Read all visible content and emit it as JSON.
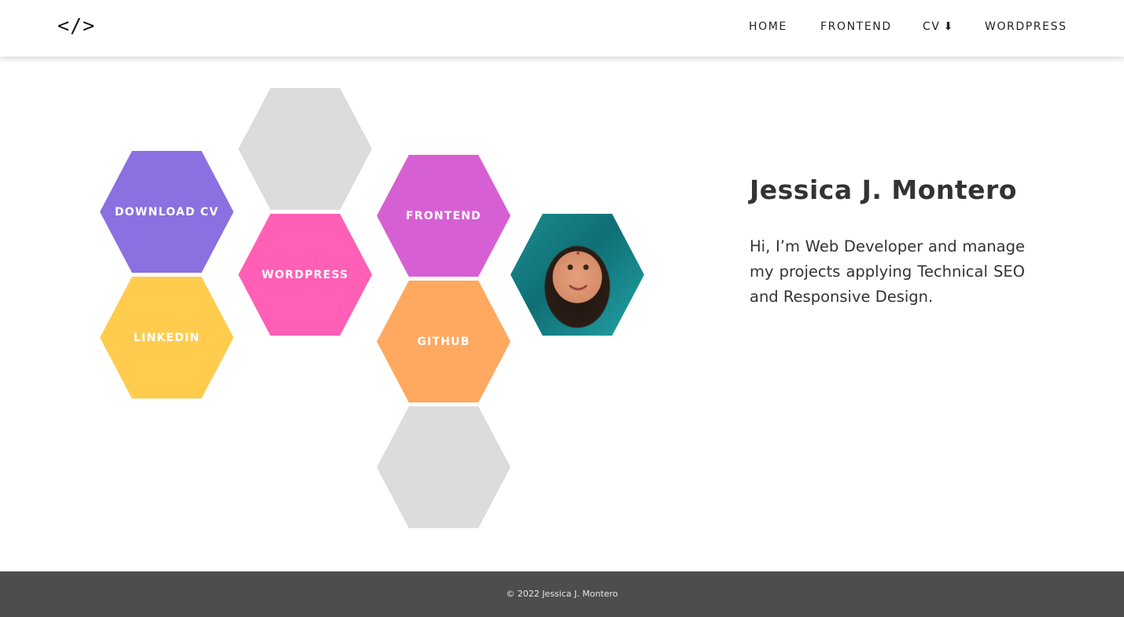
{
  "header": {
    "logo": "</>",
    "nav": [
      {
        "label": "HOME"
      },
      {
        "label": "FRONTEND"
      },
      {
        "label": "CV",
        "arrow": "⬇"
      },
      {
        "label": "WORDPRESS"
      }
    ]
  },
  "hexes": {
    "download_cv": {
      "label": "DOWNLOAD CV",
      "color": "#8a70e0"
    },
    "linkedin": {
      "label": "LINKEDIN",
      "color": "#ffcc4d"
    },
    "wordpress": {
      "label": "WORDPRESS",
      "color": "#ff5fb5"
    },
    "frontend": {
      "label": "FRONTEND",
      "color": "#d75fd4"
    },
    "github": {
      "label": "GITHUB",
      "color": "#ffa860"
    },
    "placeholder_color": "#dcdcdc"
  },
  "profile": {
    "name": "Jessica J. Montero",
    "bio": "Hi, I’m Web Developer and manage my projects applying Technical SEO and Responsive Design."
  },
  "footer": {
    "copyright": "© 2022 Jessica J. Montero"
  }
}
